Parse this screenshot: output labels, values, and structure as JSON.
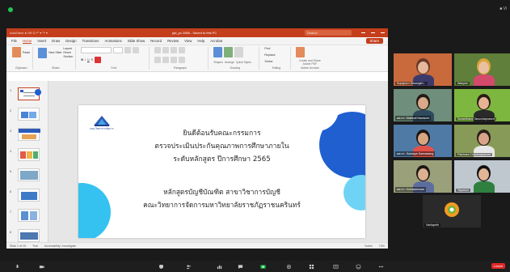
{
  "status": {
    "top_right": "■ Vi"
  },
  "ppt": {
    "title_left": "AutoSave  ● Off  ⊡  ↶ ▾  ↷  ▾",
    "title_doc": "ppt_pc 2565 - Saved to this PC",
    "search_placeholder": "Search",
    "menus": [
      "File",
      "Home",
      "Insert",
      "Draw",
      "Design",
      "Transitions",
      "Animations",
      "Slide Show",
      "Record",
      "Review",
      "View",
      "Help",
      "Acrobat"
    ],
    "active_menu": "Home",
    "share_label": "Share",
    "ribbon": {
      "paste": "Paste",
      "new_slide": "New Slide",
      "layout": "Layout",
      "reset": "Reset",
      "section": "Section",
      "clipboard": "Clipboard",
      "slides": "Slides",
      "font": "Font",
      "paragraph": "Paragraph",
      "shapes": "Shapes",
      "arrange": "Arrange",
      "quick_styles": "Quick Styles",
      "drawing": "Drawing",
      "find": "Find",
      "replace": "Replace",
      "select": "Select",
      "editing": "Editing",
      "create_share": "Create and Share Adobe PDF",
      "adobe_acrobat": "Adobe Acrobat"
    },
    "slide_numbers": [
      "1",
      "2",
      "3",
      "4",
      "5",
      "6",
      "7",
      "8"
    ],
    "slide": {
      "logo_text": "คณะวิทยาการจัดการ",
      "line1": "ยินดีต้อนรับคณะกรรมการ",
      "line2": "ตรวจประเมินประกันคุณภาพการศึกษาภายใน",
      "line3": "ระดับหลักสูตร ปีการศึกษา 2565",
      "line4": "หลักสูตรบัญชีบัณฑิต สาขาวิชาการบัญชี",
      "line5": "คณะวิทยาการจัดการมหาวิทยาลัยราชภัฏราชนครินทร์"
    },
    "status": {
      "slide_of": "Slide 1 of 15",
      "language": "Thai",
      "accessibility": "Accessibility: Investigate",
      "notes": "Notes",
      "zoom": "74%"
    }
  },
  "participants": [
    {
      "name": "Supaporn Srisangkh..."
    },
    {
      "name": "Wanpen"
    },
    {
      "name": "ผศ.ดร. Mathudi Nawsurin"
    },
    {
      "name": "Sunanthana Tanuchatprasert"
    },
    {
      "name": "ผศ.ดร. Sukanya Sansawang"
    },
    {
      "name": "Patchara Chaohuapanom"
    },
    {
      "name": "ผศ.ดร. Kulhaweewan"
    },
    {
      "name": "Tapanon"
    },
    {
      "name": "Vanlapeth"
    }
  ],
  "controls": {
    "leave": "Leave"
  },
  "colors": {
    "ppt_red": "#c43e1c",
    "slide_blue": "#1f5fd0",
    "slide_cyan": "#35c2f0",
    "meeting_green": "#23c552"
  }
}
